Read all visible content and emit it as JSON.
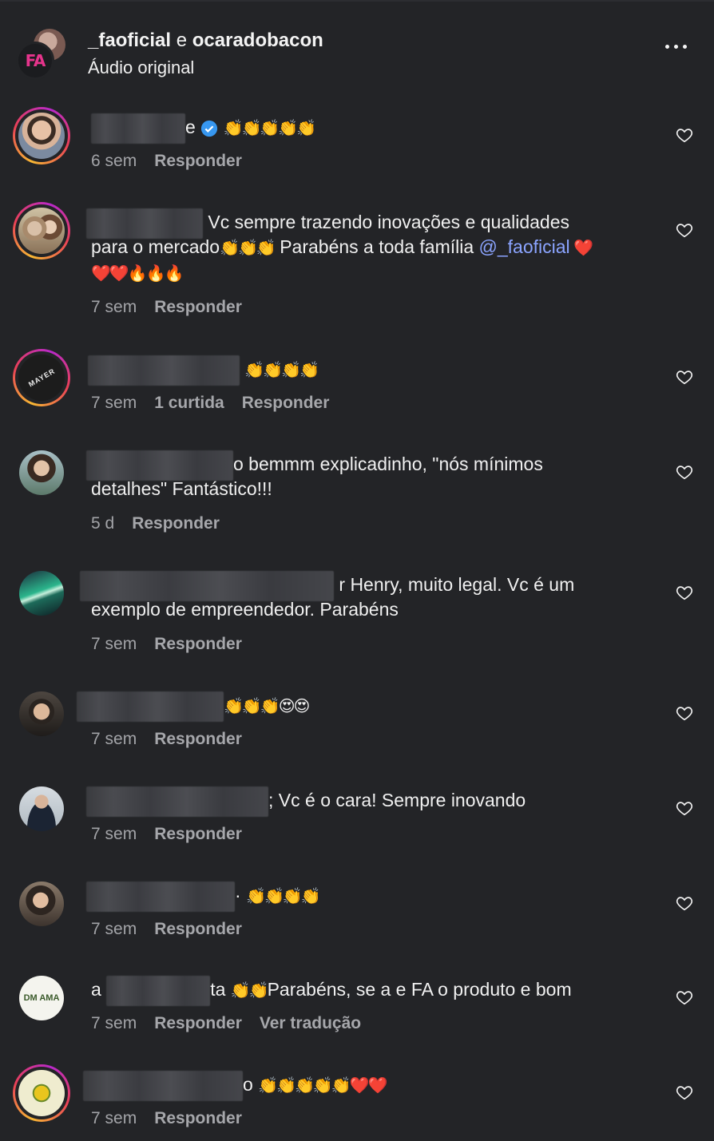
{
  "header": {
    "user1": "_faoficial",
    "conjunction": "e",
    "user2": "ocaradobacon",
    "subtitle": "Áudio original",
    "avatar_text": "FA"
  },
  "comments": [
    {
      "text_after": "e",
      "emoji": "👏👏👏👏👏",
      "text_tail": "",
      "line2": "",
      "line3": "",
      "age": "6 sem",
      "likes": "",
      "reply": "Responder",
      "translate": "",
      "verified": true
    },
    {
      "text_after": "Vc sempre trazendo inovações e qualidades",
      "emoji": "",
      "text_tail": "",
      "line2_a": "para o mercado",
      "line2_emoji": "👏👏👏",
      "line2_b": " Parabéns a toda família ",
      "line2_mention": "@_faoficial",
      "line2_emoji2": " ❤️",
      "line3": "❤️❤️🔥🔥🔥",
      "age": "7 sem",
      "likes": "",
      "reply": "Responder",
      "translate": ""
    },
    {
      "text_after": "",
      "emoji": "👏👏👏👏",
      "text_tail": "",
      "line2": "",
      "age": "7 sem",
      "likes": "1 curtida",
      "reply": "Responder",
      "translate": ""
    },
    {
      "text_after": "o bemmm explicadinho, \"nós mínimos",
      "emoji": "",
      "line2": "detalhes\" Fantástico!!!",
      "age": "5 d",
      "likes": "",
      "reply": "Responder",
      "translate": ""
    },
    {
      "text_after": "r Henry, muito legal. Vc é um",
      "emoji": "",
      "line2": "exemplo de empreendedor. Parabéns",
      "age": "7 sem",
      "likes": "",
      "reply": "Responder",
      "translate": ""
    },
    {
      "text_after": "",
      "emoji": "👏👏👏😍😍",
      "line2": "",
      "age": "7 sem",
      "likes": "",
      "reply": "Responder",
      "translate": ""
    },
    {
      "text_after": "; Vc é o cara! Sempre inovando",
      "emoji": "",
      "line2": "",
      "age": "7 sem",
      "likes": "",
      "reply": "Responder",
      "translate": ""
    },
    {
      "text_after": "·",
      "emoji": "👏👏👏👏",
      "line2": "",
      "age": "7 sem",
      "likes": "",
      "reply": "Responder",
      "translate": ""
    },
    {
      "text_before": "a",
      "text_after": "ta",
      "emoji": "👏👏",
      "text_tail": "Parabéns, se a e FA o produto e bom",
      "line2": "",
      "age": "7 sem",
      "likes": "",
      "reply": "Responder",
      "translate": "Ver tradução"
    },
    {
      "text_after": "o",
      "emoji": "👏👏👏👏👏❤️❤️",
      "line2": "",
      "age": "7 sem",
      "likes": "",
      "reply": "Responder",
      "translate": ""
    }
  ],
  "avatars": [
    {
      "name": "avatar-man-beard",
      "bg": "#8a6a58"
    },
    {
      "name": "avatar-couple",
      "bg": "#a08468"
    },
    {
      "name": "avatar-mayer-logo",
      "bg": "#1a1a1a",
      "label": "MAYER"
    },
    {
      "name": "avatar-woman",
      "bg": "#6f7f8a"
    },
    {
      "name": "avatar-aurora",
      "bg": "#1f4a45"
    },
    {
      "name": "avatar-man-glasses",
      "bg": "#3e3a36"
    },
    {
      "name": "avatar-man-suit",
      "bg": "#c7cfd6"
    },
    {
      "name": "avatar-woman-2",
      "bg": "#5a4c44"
    },
    {
      "name": "avatar-dm-ama-logo",
      "bg": "#f4f4f0",
      "label": "DM AMA"
    },
    {
      "name": "avatar-yellow-logo",
      "bg": "#e8e4c4"
    }
  ]
}
